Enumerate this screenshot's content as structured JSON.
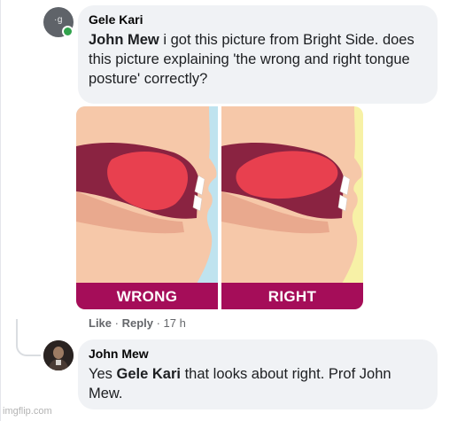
{
  "comment_1": {
    "avatar_text": "·g",
    "author": "Gele Kari",
    "mention": "John Mew",
    "text": " i got this picture from Bright Side. does this picture explaining 'the wrong and right tongue posture' correctly?",
    "image": {
      "left_label": "WRONG",
      "right_label": "RIGHT"
    },
    "actions": {
      "like": "Like",
      "separator": " · ",
      "reply": "Reply",
      "time": "17 h"
    }
  },
  "comment_2": {
    "author": "John Mew",
    "prefix": "Yes ",
    "mention": "Gele Kari",
    "text": " that looks about right. Prof John Mew."
  },
  "watermark": "imgflip.com",
  "colors": {
    "bubble": "#f0f2f5",
    "label_bar": "#a50d59",
    "skin": "#f6c8a9",
    "tongue": "#e8404f",
    "wrong_bg": "#bfe3ef",
    "right_bg": "#f7f1a6",
    "online": "#31a24c"
  }
}
